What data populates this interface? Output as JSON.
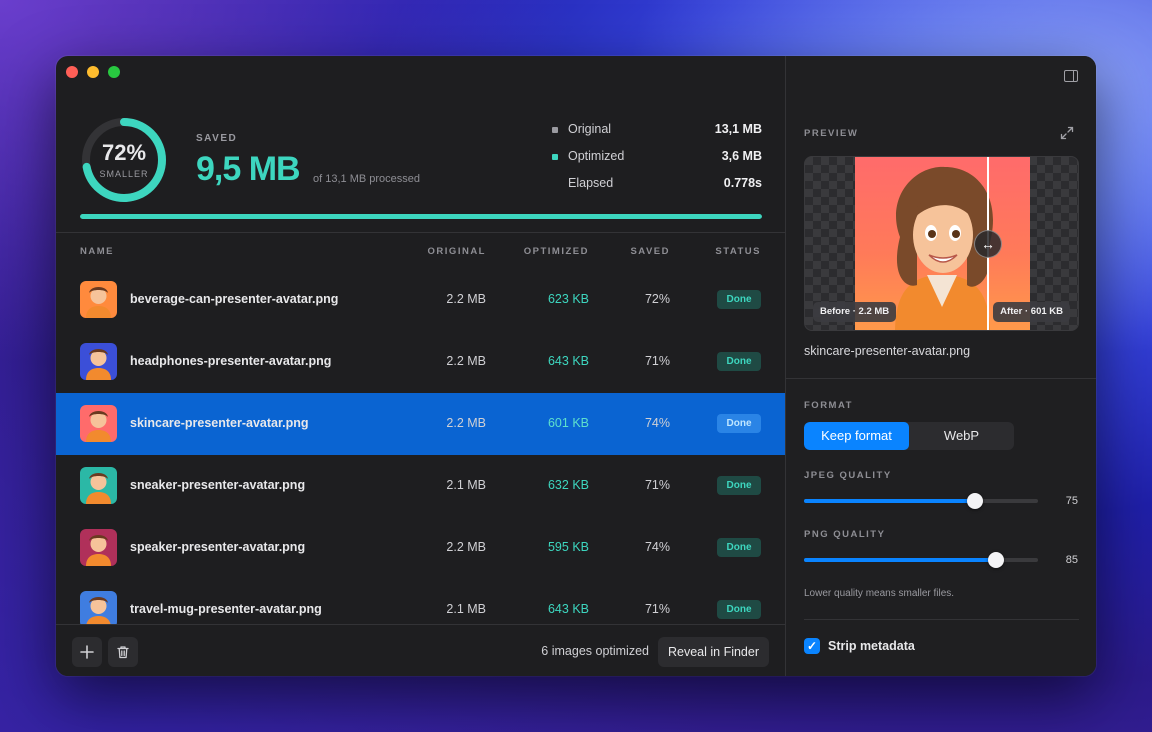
{
  "summary": {
    "ring_percent": "72%",
    "ring_sub": "SMALLER",
    "ring_fraction": 0.72,
    "saved_label": "SAVED",
    "saved_value": "9,5 MB",
    "saved_of": "of 13,1 MB processed",
    "progress_fraction": 1.0,
    "stats": [
      {
        "label": "Original",
        "value": "13,1 MB",
        "dot_color": "#9a9aa0"
      },
      {
        "label": "Optimized",
        "value": "3,6 MB",
        "dot_color": "#3dd6bf"
      },
      {
        "label": "Elapsed",
        "value": "0.778s",
        "dot_color": ""
      }
    ]
  },
  "table": {
    "headers": {
      "name": "NAME",
      "original": "ORIGINAL",
      "optimized": "OPTIMIZED",
      "saved": "SAVED",
      "status": "STATUS"
    },
    "rows": [
      {
        "name": "beverage-can-presenter-avatar.png",
        "original": "2.2 MB",
        "optimized": "623 KB",
        "saved": "72%",
        "status": "Done",
        "bg": "#ff8a3d"
      },
      {
        "name": "headphones-presenter-avatar.png",
        "original": "2.2 MB",
        "optimized": "643 KB",
        "saved": "71%",
        "status": "Done",
        "bg": "#3b4fd8"
      },
      {
        "name": "skincare-presenter-avatar.png",
        "original": "2.2 MB",
        "optimized": "601 KB",
        "saved": "74%",
        "status": "Done",
        "bg": "#ff6b6b"
      },
      {
        "name": "sneaker-presenter-avatar.png",
        "original": "2.1 MB",
        "optimized": "632 KB",
        "saved": "71%",
        "status": "Done",
        "bg": "#2bb8a6"
      },
      {
        "name": "speaker-presenter-avatar.png",
        "original": "2.2 MB",
        "optimized": "595 KB",
        "saved": "74%",
        "status": "Done",
        "bg": "#b0305a"
      },
      {
        "name": "travel-mug-presenter-avatar.png",
        "original": "2.1 MB",
        "optimized": "643 KB",
        "saved": "71%",
        "status": "Done",
        "bg": "#3f7de0"
      }
    ]
  },
  "footer": {
    "count_text": "6 images optimized",
    "reveal_label": "Reveal in Finder"
  },
  "preview": {
    "label": "PREVIEW",
    "before_badge": "Before · 2.2 MB",
    "after_badge": "After · 601 KB",
    "filename": "skincare-presenter-avatar.png"
  },
  "format": {
    "label": "FORMAT",
    "options": [
      "Keep format",
      "WebP"
    ],
    "selected": "Keep format"
  },
  "jpeg": {
    "label": "JPEG QUALITY",
    "value": "75",
    "fraction": 0.73
  },
  "png": {
    "label": "PNG QUALITY",
    "value": "85",
    "fraction": 0.82
  },
  "hint": "Lower quality means smaller files.",
  "strip_metadata": {
    "label": "Strip metadata",
    "checked": true
  }
}
